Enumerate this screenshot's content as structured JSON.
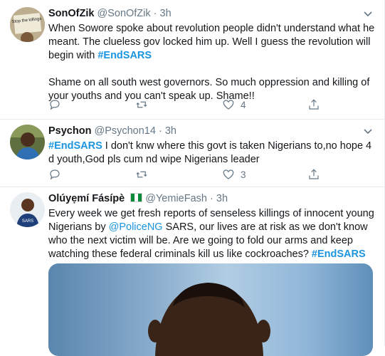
{
  "tweets": [
    {
      "name": "SonOfZik",
      "handle": "@SonOfZik",
      "dot": "·",
      "time": "3h",
      "text_p1": "When Sowore spoke about revolution people didn't understand what he meant. The clueless gov locked him up. Well I guess the revolution will begin with ",
      "hashtag": "#EndSARS",
      "text_p2": "Shame on all south west governors. So much oppression and killing of your youths and you can't speak up. Shame!!",
      "reply_count": "",
      "retweet_count": "",
      "like_count": "4",
      "avatar_sign_text": "Stop the killings"
    },
    {
      "name": "Psychon",
      "handle": "@Psychon14",
      "dot": "·",
      "time": "3h",
      "hashtag": "#EndSARS",
      "text": " I don't knw where this govt is taken Nigerians to,no hope 4 d youth,God pls cum nd wipe Nigerians leader",
      "reply_count": "",
      "retweet_count": "",
      "like_count": "3"
    },
    {
      "name": "Olúyẹmí Fásípè",
      "handle": "@YemieFash",
      "dot": "·",
      "time": "3h",
      "text_p1": "Every week we get fresh reports of senseless killings of innocent young Nigerians by ",
      "mention": "@PoliceNG",
      "text_p2": " SARS, our lives are at risk as we don't know who the next victim will be. Are we going to fold our arms and keep watching these federal criminals kill us like cockroaches? ",
      "hashtag": "#EndSARS",
      "avatar_shirt_text": "SARS"
    }
  ],
  "colors": {
    "link": "#1b95e0",
    "muted": "#657786",
    "border": "#e6ecf0"
  },
  "icons": [
    "reply-icon",
    "retweet-icon",
    "like-icon",
    "share-icon",
    "caret-down-icon",
    "nigeria-flag-icon"
  ]
}
